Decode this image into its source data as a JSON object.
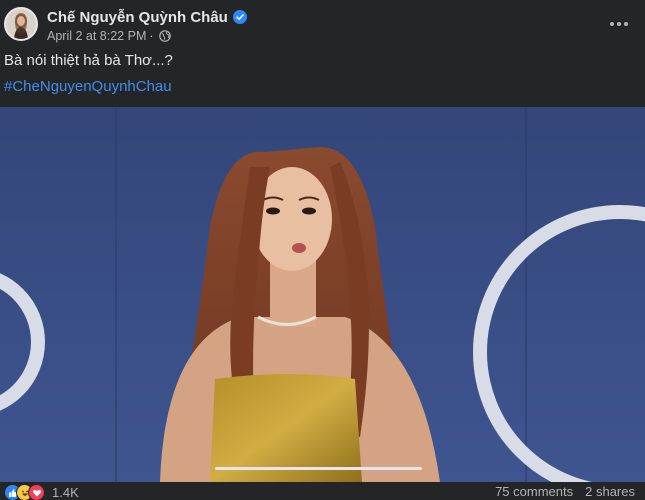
{
  "post": {
    "author_name": "Chế Nguyễn Quỳnh Châu",
    "timestamp": "April 2 at 8:22 PM",
    "separator": "·",
    "text": "Bà nói thiệt hả bà Thơ...?",
    "hashtag": "#CheNguyenQuynhChau"
  },
  "icons": {
    "verified": "verified-badge-icon",
    "privacy": "globe-icon",
    "more": "more-options-icon"
  },
  "reactions": {
    "types": [
      "like",
      "haha",
      "love"
    ],
    "count": "1.4K"
  },
  "stats": {
    "comments": "75 comments",
    "shares": "2 shares"
  },
  "colors": {
    "background": "#242526",
    "primary_text": "#e4e6eb",
    "secondary_text": "#b0b3b8",
    "link": "#3f8ef0",
    "verified": "#2d88ff"
  }
}
